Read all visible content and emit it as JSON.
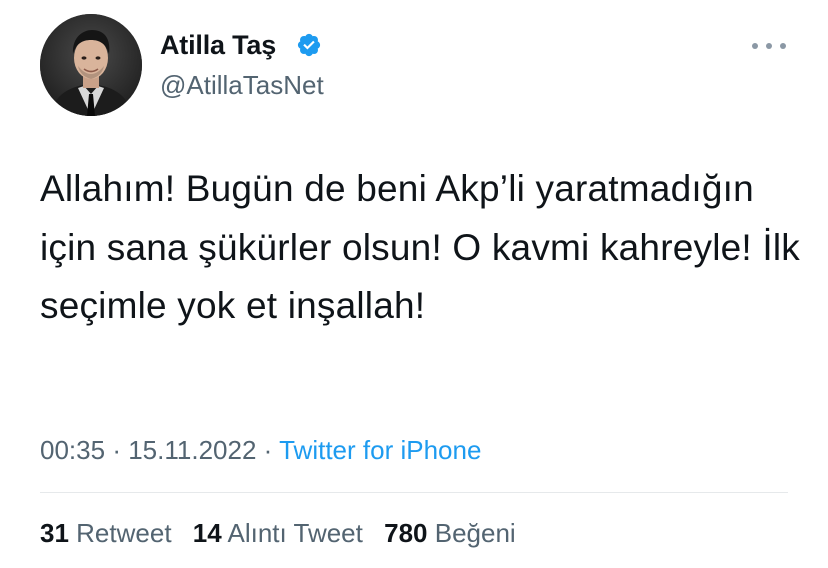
{
  "author": {
    "display_name": "Atilla Taş",
    "handle": "@AtillaTasNet",
    "verified": true,
    "avatar_icon": "profile-photo"
  },
  "tweet": {
    "text": "Allahım! Bugün de beni Akp’li yaratmadığın için sana şükürler olsun! O kavmi kahreyle! İlk seçimle yok et inşallah!",
    "time": "00:35",
    "date": "15.11.2022",
    "separator": "·",
    "source": "Twitter for iPhone"
  },
  "stats": {
    "retweets_count": "31",
    "retweets_label": "Retweet",
    "quotes_count": "14",
    "quotes_label": "Alıntı Tweet",
    "likes_count": "780",
    "likes_label": "Beğeni"
  },
  "colors": {
    "accent": "#1d9bf0",
    "secondary_text": "#536471",
    "primary_text": "#0f1419"
  },
  "icons": {
    "verified": "verified-badge-icon",
    "more": "more-options-icon"
  }
}
